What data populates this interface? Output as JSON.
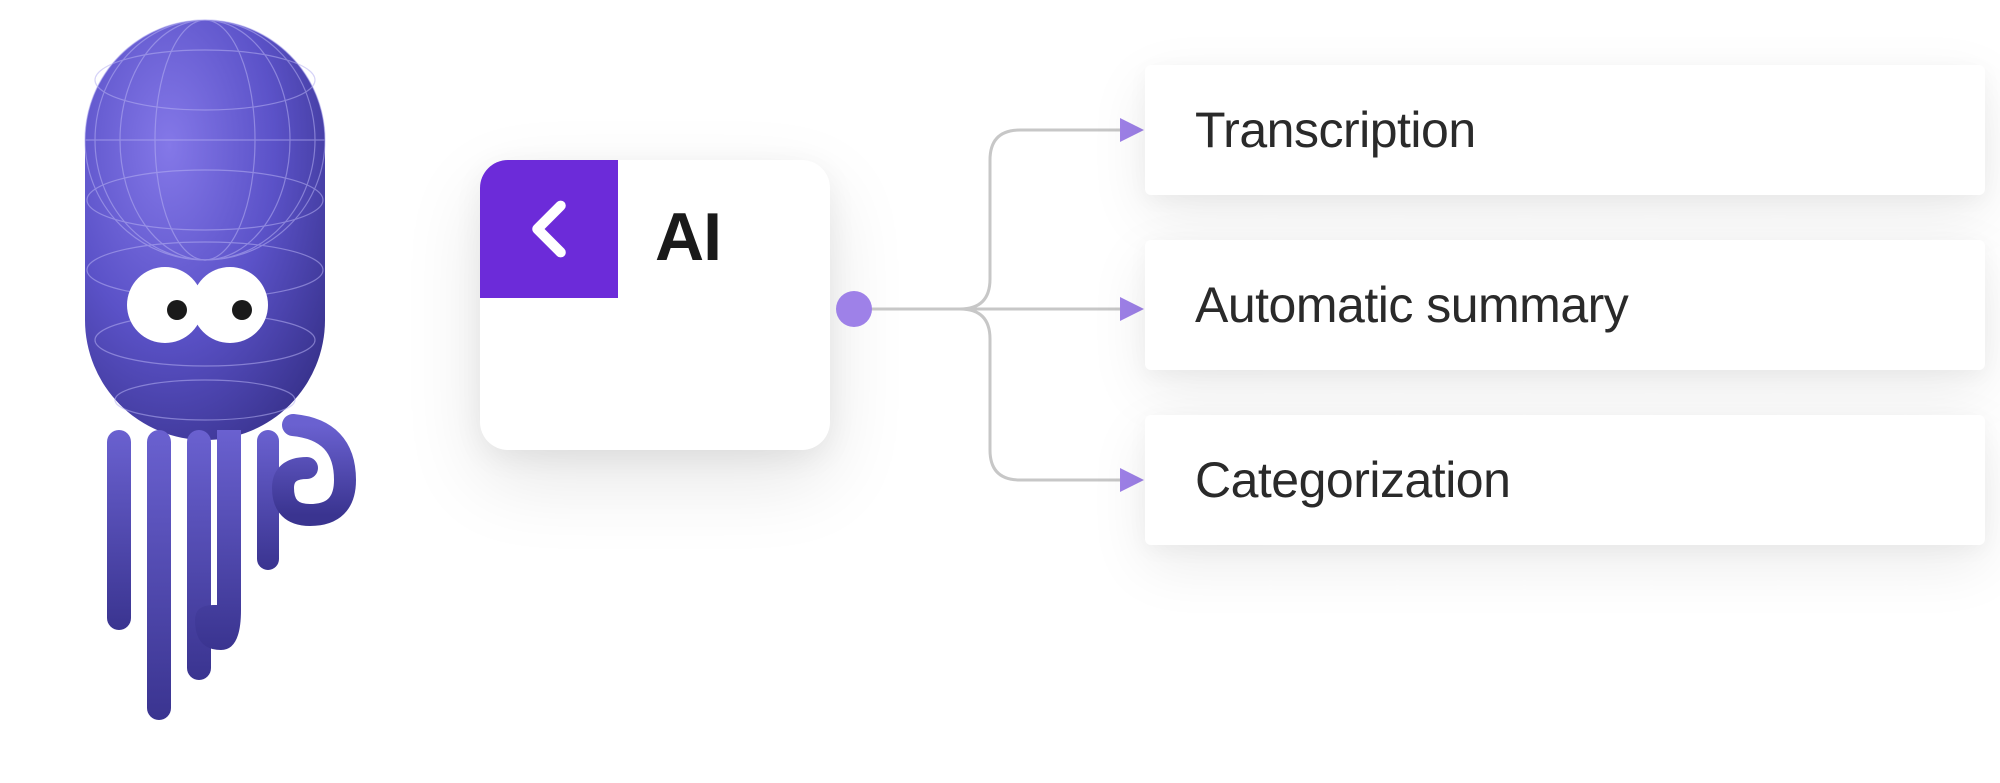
{
  "mascot": {
    "name": "octopus-mascot"
  },
  "ai_card": {
    "label": "AI"
  },
  "features": [
    {
      "label": "Transcription"
    },
    {
      "label": "Automatic summary"
    },
    {
      "label": "Categorization"
    }
  ],
  "colors": {
    "accent": "#6C2BD9",
    "accent_light": "#9E81E8",
    "connector": "#c7c7c7",
    "text": "#2a2a2a"
  }
}
